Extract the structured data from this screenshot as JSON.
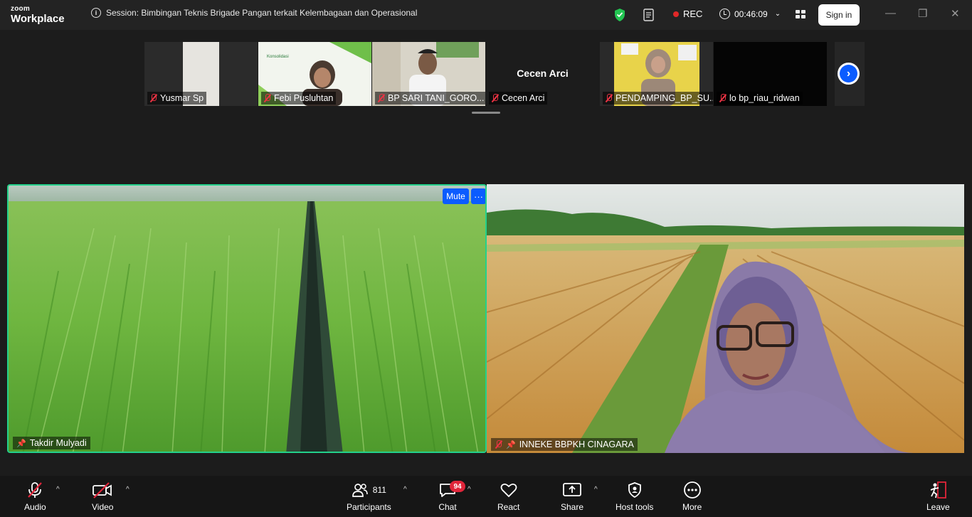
{
  "app": {
    "brand_line1": "zoom",
    "brand_line2": "Workplace"
  },
  "header": {
    "session_title": "Session: Bimbingan Teknis Brigade Pangan terkait Kelembagaan dan Operasional",
    "rec_label": "REC",
    "elapsed": "00:46:09",
    "signin_label": "Sign in"
  },
  "thumbnails": [
    {
      "name": "Yusmar Sp",
      "muted": true
    },
    {
      "name": "Febi Pusluhtan",
      "muted": true
    },
    {
      "name": "BP SARI TANI_GORO...",
      "muted": true
    },
    {
      "name": "Cecen Arci",
      "muted": true,
      "center_label": "Cecen Arci"
    },
    {
      "name": "PENDAMPING_BP_SU...",
      "muted": true
    },
    {
      "name": "lo bp_riau_ridwan",
      "muted": true
    }
  ],
  "main_videos": [
    {
      "name": "Takdir Mulyadi",
      "mute_label": "Mute",
      "more_label": "···"
    },
    {
      "name": "INNEKE BBPKH CINAGARA"
    }
  ],
  "toolbar": {
    "audio": "Audio",
    "video": "Video",
    "participants": "Participants",
    "participants_count": "811",
    "chat": "Chat",
    "chat_badge": "94",
    "react": "React",
    "share": "Share",
    "host_tools": "Host tools",
    "more": "More",
    "leave": "Leave"
  },
  "colors": {
    "accent": "#0b5cff",
    "active_speaker": "#23d18b",
    "rec": "#e02828",
    "badge": "#e0253a"
  }
}
